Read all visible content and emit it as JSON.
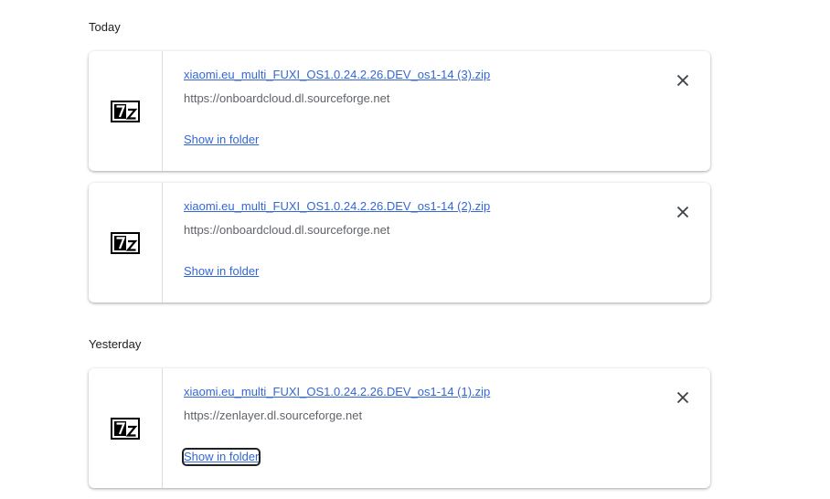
{
  "sections": [
    {
      "heading": "Today",
      "items": [
        {
          "file_name": "xiaomi.eu_multi_FUXI_OS1.0.24.2.26.DEV_os1-14 (3).zip",
          "url": "https://onboardcloud.dl.sourceforge.net",
          "action_label": "Show in folder",
          "icon": "7z-archive-icon"
        },
        {
          "file_name": "xiaomi.eu_multi_FUXI_OS1.0.24.2.26.DEV_os1-14 (2).zip",
          "url": "https://onboardcloud.dl.sourceforge.net",
          "action_label": "Show in folder",
          "icon": "7z-archive-icon"
        }
      ]
    },
    {
      "heading": "Yesterday",
      "items": [
        {
          "file_name": "xiaomi.eu_multi_FUXI_OS1.0.24.2.26.DEV_os1-14 (1).zip",
          "url": "https://zenlayer.dl.sourceforge.net",
          "action_label": "Show in folder",
          "icon": "7z-archive-icon",
          "focused": true
        }
      ]
    }
  ],
  "colors": {
    "link": "#3367d6",
    "secondary_text": "#5f6368",
    "divider": "#dadce0"
  }
}
